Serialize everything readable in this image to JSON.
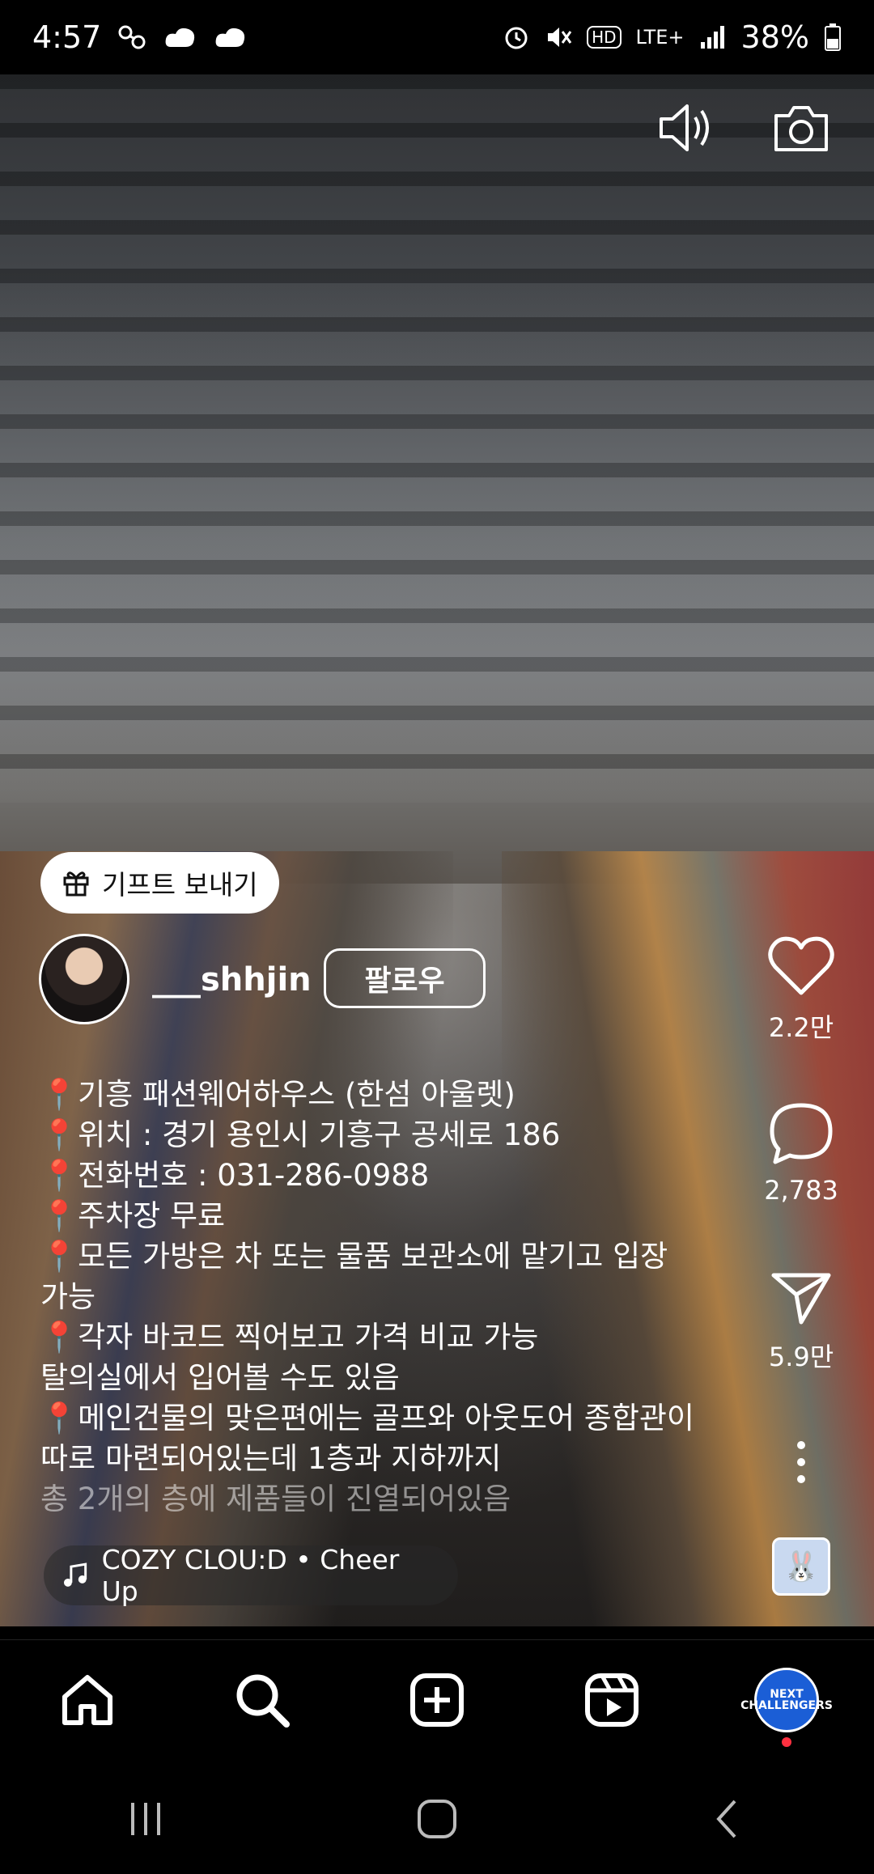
{
  "status_bar": {
    "time": "4:57",
    "battery": "38%",
    "network": "LTE+",
    "left_icons": [
      "link-icon",
      "cloud-icon",
      "cloud-icon"
    ],
    "right_icons": [
      "alarm-icon",
      "mute-icon",
      "hd-icon",
      "lte-icon",
      "signal-icon",
      "battery-icon"
    ]
  },
  "reel": {
    "top_icons": [
      "volume-icon",
      "camera-icon"
    ],
    "gift_label": "기프트 보내기",
    "username": "___shhjin",
    "follow_label": "팔로우",
    "caption_lines": [
      "📍기흥 패션웨어하우스 (한섬 아울렛)",
      "📍위치 : 경기 용인시 기흥구 공세로 186",
      "📍전화번호 : 031-286-0988",
      "📍주차장 무료",
      "📍모든 가방은 차 또는 물품 보관소에 맡기고 입장",
      "가능",
      "📍각자 바코드 찍어보고 가격 비교 가능",
      " 탈의실에서 입어볼 수도 있음",
      "📍메인건물의 맞은편에는 골프와 아웃도어 종합관이",
      " 따로 마련되어있는데 1층과 지하까지",
      " 총 2개의 층에 제품들이 진열되어있음"
    ],
    "music": "COZY CLOU:D • Cheer Up",
    "likes": "2.2만",
    "comments": "2,783",
    "shares": "5.9만"
  },
  "bottom_nav": {
    "items": [
      "home-icon",
      "search-icon",
      "create-icon",
      "reels-icon",
      "profile"
    ],
    "profile_text": "NEXT CHALLENGERS"
  },
  "system_nav": [
    "recents-icon",
    "home-button-icon",
    "back-icon"
  ],
  "colors": {
    "background": "#000000",
    "pin": "#e0242e",
    "notification_dot": "#ff3040",
    "profile_badge": "#1b5ed6"
  }
}
